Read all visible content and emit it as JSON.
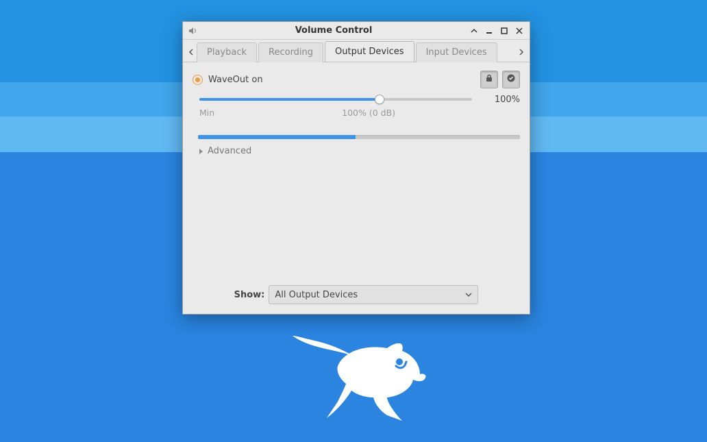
{
  "window": {
    "title": "Volume Control"
  },
  "tabs": {
    "playback": "Playback",
    "recording": "Recording",
    "output": "Output Devices",
    "input": "Input Devices",
    "active": "output"
  },
  "device": {
    "name": "WaveOut on",
    "volume_percent_label": "100%",
    "slider_fill_percent": 66,
    "slider_thumb_percent": 66,
    "scale_min": "Min",
    "scale_100": "100% (0 dB)",
    "vu_fill_percent": 49,
    "advanced_label": "Advanced",
    "lock_channels_pressed": true,
    "set_default_pressed": true
  },
  "footer": {
    "show_label": "Show:",
    "show_value": "All Output Devices"
  }
}
